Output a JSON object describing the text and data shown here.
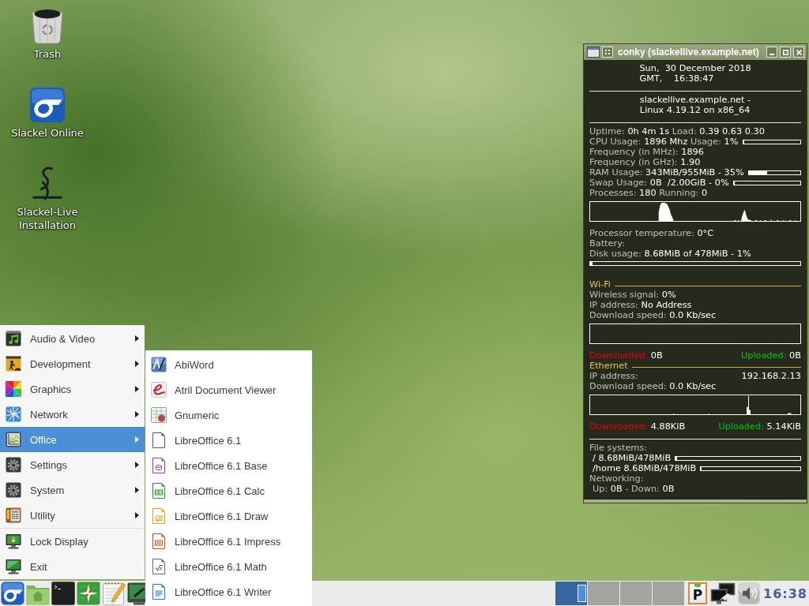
{
  "desktop_icons": [
    {
      "label": "Trash"
    },
    {
      "label": "Slackel Online"
    },
    {
      "label": "Slackel-Live Installation"
    }
  ],
  "conky": {
    "title": "conky (slackellive.example.net)",
    "items": [
      {
        "kind": "block",
        "lines": [
          "Sun,  30 December 2018",
          "GMT,    16:38:47"
        ]
      },
      {
        "kind": "rule"
      },
      {
        "kind": "block",
        "lines": [
          "slackellive.example.net -",
          "Linux 4.19.12 on x86_64"
        ]
      },
      {
        "kind": "rule"
      },
      {
        "kind": "line",
        "parts": [
          {
            "label": "Uptime:",
            "value": "0h 4m 1s"
          },
          {
            "label": "Load:",
            "value": "0.39 0.63 0.30"
          }
        ]
      },
      {
        "kind": "line",
        "parts": [
          {
            "label": "CPU Usage:",
            "value": "1896 Mhz"
          },
          {
            "label": "Usage:",
            "value": "1%"
          }
        ],
        "level": 0.01
      },
      {
        "kind": "line",
        "parts": [
          {
            "label": "Frequency (in MHz):",
            "value": "1896"
          }
        ]
      },
      {
        "kind": "line",
        "parts": [
          {
            "label": "Frequency (in GHz):",
            "value": "1.90"
          }
        ]
      },
      {
        "kind": "line",
        "parts": [
          {
            "label": "RAM Usage:",
            "value": "343MiB/955MiB - 35%"
          }
        ],
        "level": 0.35
      },
      {
        "kind": "line",
        "parts": [
          {
            "label": "Swap Usage:",
            "value": "0B  /2.00GiB - 0%"
          }
        ],
        "level": 0
      },
      {
        "kind": "line",
        "parts": [
          {
            "label": "Processes:",
            "value": "180"
          },
          {
            "label": "Running:",
            "value": "0"
          }
        ]
      },
      {
        "kind": "cpu_graph"
      },
      {
        "kind": "line",
        "parts": [
          {
            "label": "Processor temperature:",
            "value": "0°C"
          }
        ]
      },
      {
        "kind": "line",
        "parts": [
          {
            "label": "Battery:"
          }
        ]
      },
      {
        "kind": "line",
        "parts": [
          {
            "label": "Disk usage:",
            "value": "8.68MiB of 478MiB - 1%"
          }
        ]
      },
      {
        "kind": "bar",
        "level": 0.01
      },
      {
        "kind": "blank"
      },
      {
        "kind": "heading",
        "text": "Wi-Fi"
      },
      {
        "kind": "line",
        "parts": [
          {
            "label": "Wireless signal:",
            "value": "0%"
          }
        ]
      },
      {
        "kind": "line",
        "parts": [
          {
            "label": "IP address:",
            "value": "No Address"
          }
        ]
      },
      {
        "kind": "line",
        "parts": [
          {
            "label": "Download speed:",
            "value": "0.0 Kb/sec"
          }
        ]
      },
      {
        "kind": "wifi_graph"
      },
      {
        "kind": "split",
        "left": {
          "label": "Downloaded:",
          "value": "0B",
          "color": "#ee0000"
        },
        "right": {
          "label": "Uploaded:",
          "value": "0B",
          "color": "#00cc00"
        }
      },
      {
        "kind": "heading",
        "text": "Ethernet"
      },
      {
        "kind": "split",
        "left": {
          "label": "IP address:"
        },
        "right": {
          "value": "192.168.2.13"
        }
      },
      {
        "kind": "line",
        "parts": [
          {
            "label": "Download speed:",
            "value": "0.0 Kb/sec"
          }
        ]
      },
      {
        "kind": "ethernet_graph"
      },
      {
        "kind": "split",
        "left": {
          "label": "Downloaded:",
          "value": "4.88KiB",
          "color": "#ee0000"
        },
        "right": {
          "label": "Uploaded:",
          "value": "5.14KiB",
          "color": "#00cc00"
        }
      },
      {
        "kind": "rule"
      },
      {
        "kind": "line",
        "parts": [
          {
            "label": "File systems:"
          }
        ]
      },
      {
        "kind": "subline",
        "parts": [
          {
            "value": "/ 8.68MiB/478MiB"
          }
        ],
        "level": 0.01
      },
      {
        "kind": "subline",
        "parts": [
          {
            "value": "/home 8.68MiB/478MiB"
          }
        ],
        "level": 0.01
      },
      {
        "kind": "line",
        "parts": [
          {
            "label": "Networking:"
          }
        ]
      },
      {
        "kind": "subline",
        "parts": [
          {
            "label": "Up:",
            "value": "0B"
          },
          {
            "label": "- Down:",
            "value": "0B"
          }
        ]
      }
    ]
  },
  "menu": {
    "categories": [
      {
        "label": "Audio & Video",
        "selected": false
      },
      {
        "label": "Development",
        "selected": false
      },
      {
        "label": "Graphics",
        "selected": false
      },
      {
        "label": "Network",
        "selected": false
      },
      {
        "label": "Office",
        "selected": true
      },
      {
        "label": "Settings",
        "selected": false
      },
      {
        "label": "System",
        "selected": false
      },
      {
        "label": "Utility",
        "selected": false
      }
    ],
    "actions": [
      {
        "label": "Lock Display"
      },
      {
        "label": "Exit"
      }
    ]
  },
  "submenu": {
    "items": [
      {
        "label": "AbiWord"
      },
      {
        "label": "Atril Document Viewer"
      },
      {
        "label": "Gnumeric"
      },
      {
        "label": "LibreOffice 6.1"
      },
      {
        "label": "LibreOffice 6.1 Base"
      },
      {
        "label": "LibreOffice 6.1 Calc"
      },
      {
        "label": "LibreOffice 6.1 Draw"
      },
      {
        "label": "LibreOffice 6.1 Impress"
      },
      {
        "label": "LibreOffice 6.1 Math"
      },
      {
        "label": "LibreOffice 6.1 Writer"
      }
    ]
  },
  "taskbar": {
    "pager": [
      {
        "selected": true,
        "has_window": true
      },
      {
        "selected": false,
        "has_window": false
      },
      {
        "selected": false,
        "has_window": false
      },
      {
        "selected": false,
        "has_window": false
      }
    ],
    "clipboard_text": "P",
    "clock": "16:38"
  }
}
